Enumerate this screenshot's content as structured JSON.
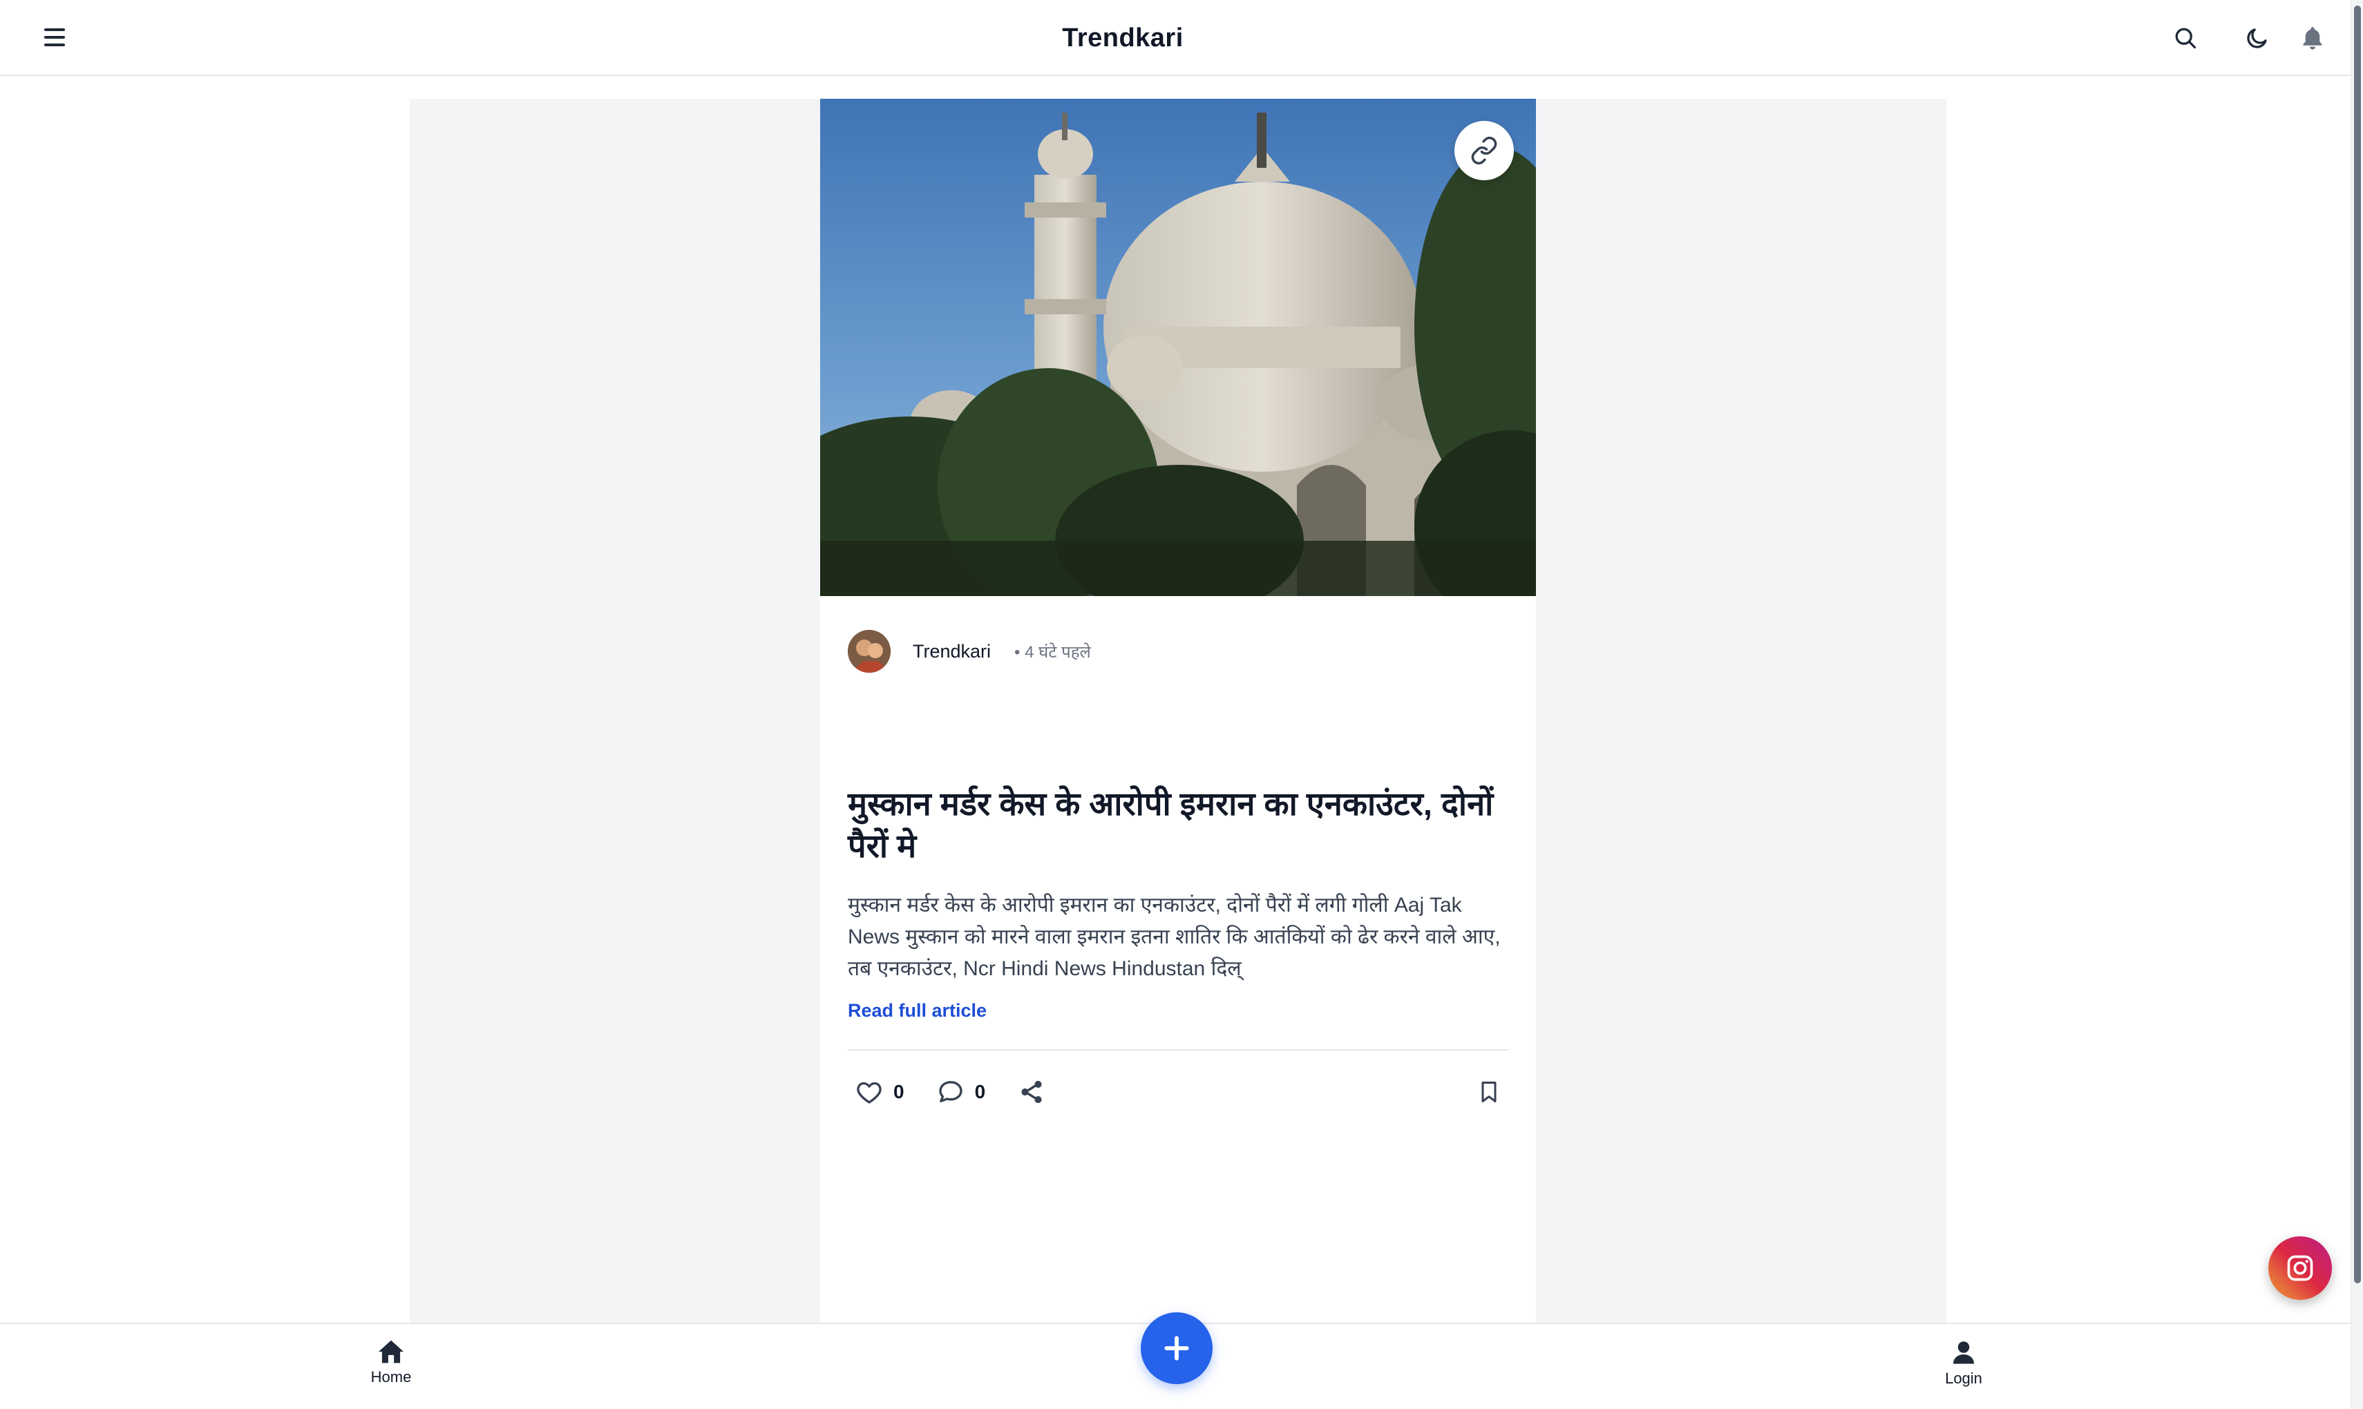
{
  "header": {
    "brand": "Trendkari",
    "icons": [
      "menu-icon",
      "search-icon",
      "moon-icon",
      "bell-icon"
    ]
  },
  "post": {
    "author": "Trendkari",
    "time": "• 4 घंटे पहले",
    "title": "मुस्कान मर्डर केस के आरोपी इमरान का एनकाउंटर, दोनों पैरों मे",
    "excerpt": "मुस्कान मर्डर केस के आरोपी इमरान का एनकाउंटर, दोनों पैरों में लगी गोली  Aaj Tak News मुस्कान को मारने वाला इमरान इतना शातिर कि आतंकियों को ढेर करने वाले आए, तब एनकाउंटर, Ncr Hindi News  Hindustan दिल्",
    "read_more": "Read full article",
    "likes": "0",
    "comments": "0"
  },
  "bottom_nav": {
    "home": "Home",
    "login": "Login"
  },
  "colors": {
    "accent": "#2563eb",
    "link": "#1d4ed8",
    "feed_bg": "#f3f4f6"
  }
}
